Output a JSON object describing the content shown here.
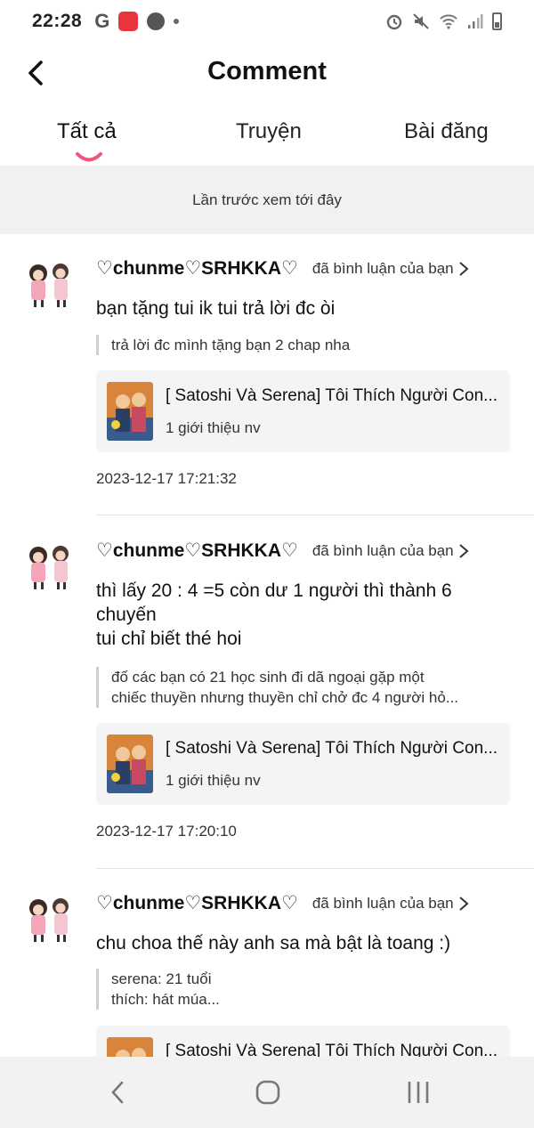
{
  "status_bar": {
    "time": "22:28",
    "g_letter": "G"
  },
  "header": {
    "title": "Comment"
  },
  "tabs": [
    {
      "label": "Tất cả",
      "active": true
    },
    {
      "label": "Truyện",
      "active": false
    },
    {
      "label": "Bài đăng",
      "active": false
    }
  ],
  "accent_color": "#f2537a",
  "banner": {
    "text": "Lần trước xem tới đây"
  },
  "comments": [
    {
      "username": "♡chunme♡SRHKKA♡",
      "action": "đã bình luận của bạn",
      "body_lines": [
        "bạn tặng tui ik tui trả lời đc òi"
      ],
      "quote_lines": [
        "trả lời đc mình tặng bạn 2 chap nha"
      ],
      "story_title": "[ Satoshi Và Serena] Tôi Thích Người Con...",
      "story_sub": "1 giới thiệu nv",
      "timestamp": "2023-12-17 17:21:32"
    },
    {
      "username": "♡chunme♡SRHKKA♡",
      "action": "đã bình luận của bạn",
      "body_lines": [
        "thì lấy 20 : 4 =5 còn dư 1 người thì thành 6",
        "chuyến",
        "tui chỉ biết thé hoi"
      ],
      "quote_lines": [
        "đố các bạn có 21 học sinh đi dã ngoại gặp một",
        "chiếc thuyền nhưng thuyền chỉ chở đc 4 người hỏ..."
      ],
      "story_title": "[ Satoshi Và Serena] Tôi Thích Người Con...",
      "story_sub": "1 giới thiệu nv",
      "timestamp": "2023-12-17 17:20:10"
    },
    {
      "username": "♡chunme♡SRHKKA♡",
      "action": "đã bình luận của bạn",
      "body_lines": [
        "chu choa thế này anh sa mà bật là toang :)"
      ],
      "quote_lines": [
        "serena: 21 tuổi",
        "thích: hát múa..."
      ],
      "story_title": "[ Satoshi Và Serena] Tôi Thích Người Con...",
      "story_sub": "",
      "timestamp": ""
    }
  ]
}
